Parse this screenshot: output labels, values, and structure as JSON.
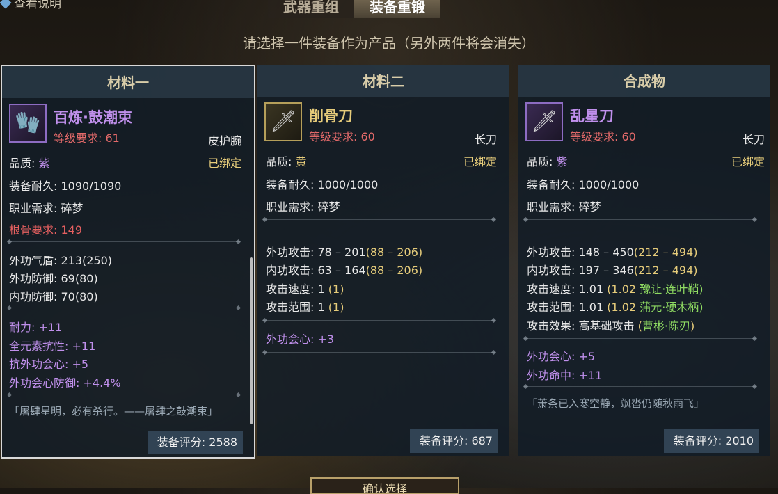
{
  "top": {
    "help_label": "查看说明",
    "tabs": [
      "武器重组",
      "装备重锻"
    ],
    "subtitle": "请选择一件装备作为产品（另外两件将会消失）"
  },
  "panels": [
    {
      "header": "材料一",
      "name": "百炼·鼓潮束",
      "level_req": "等级要求: 61",
      "type": "皮护腕",
      "quality_label": "品质:",
      "quality_value": "紫",
      "bound": "已绑定",
      "durability_label": "装备耐久:",
      "durability_value": "1090/1090",
      "job_label": "职业需求:",
      "job_value": "碎梦",
      "root_label": "根骨要求:",
      "root_value": "149",
      "stats": [
        "外功气盾: 213(250)",
        "外功防御: 69(80)",
        "内功防御: 70(80)"
      ],
      "bonuses": [
        "耐力: +11",
        "全元素抗性: +11",
        "抗外功会心: +5",
        "外功会心防御: +4.4%"
      ],
      "quote": "「屠肆星明，必有杀行。——屠肆之鼓潮束」",
      "score": "装备评分: 2588"
    },
    {
      "header": "材料二",
      "name": "削骨刀",
      "level_req": "等级要求: 60",
      "type": "长刀",
      "quality_label": "品质:",
      "quality_value": "黄",
      "bound": "已绑定",
      "durability_label": "装备耐久:",
      "durability_value": "1000/1000",
      "job_label": "职业需求:",
      "job_value": "碎梦",
      "stats": [
        {
          "label": "外功攻击:",
          "value": "78 – 201",
          "range": "(88 – 206)"
        },
        {
          "label": "内功攻击:",
          "value": "63 – 164",
          "range": "(88 – 206)"
        },
        {
          "label": "攻击速度:",
          "value": "1",
          "range": "(1)"
        },
        {
          "label": "攻击范围:",
          "value": "1",
          "range": "(1)"
        }
      ],
      "bonuses": [
        "外功会心: +3"
      ],
      "score": "装备评分: 687"
    },
    {
      "header": "合成物",
      "name": "乱星刀",
      "level_req": "等级要求: 60",
      "type": "长刀",
      "quality_label": "品质:",
      "quality_value": "紫",
      "bound": "已绑定",
      "durability_label": "装备耐久:",
      "durability_value": "1000/1000",
      "job_label": "职业需求:",
      "job_value": "碎梦",
      "stats": [
        {
          "label": "外功攻击:",
          "value": "148 – 450",
          "range": "(212 – 494)"
        },
        {
          "label": "内功攻击:",
          "value": "197 – 346",
          "range": "(212 – 494)"
        },
        {
          "label": "攻击速度:",
          "value": "1.01",
          "range": "(1.02",
          "extra": "豫让·连叶鞘)"
        },
        {
          "label": "攻击范围:",
          "value": "1.01",
          "range": "(1.02",
          "extra": "蒲元·硬木柄)"
        },
        {
          "label": "攻击效果:",
          "value": "高基础攻击",
          "range": "(",
          "extra": "曹彬·陈刃",
          "tail": ")"
        }
      ],
      "bonuses": [
        "外功会心: +5",
        "外功命中: +11"
      ],
      "quote": "「萧条已入寒空静，飒沓仍随秋雨飞」",
      "score": "装备评分: 2010"
    }
  ],
  "bottom_button": "确认选择",
  "colors": {
    "purple": "#c090ec",
    "gold": "#e6cc7a",
    "red": "#e66060",
    "green": "#8fdb62"
  }
}
